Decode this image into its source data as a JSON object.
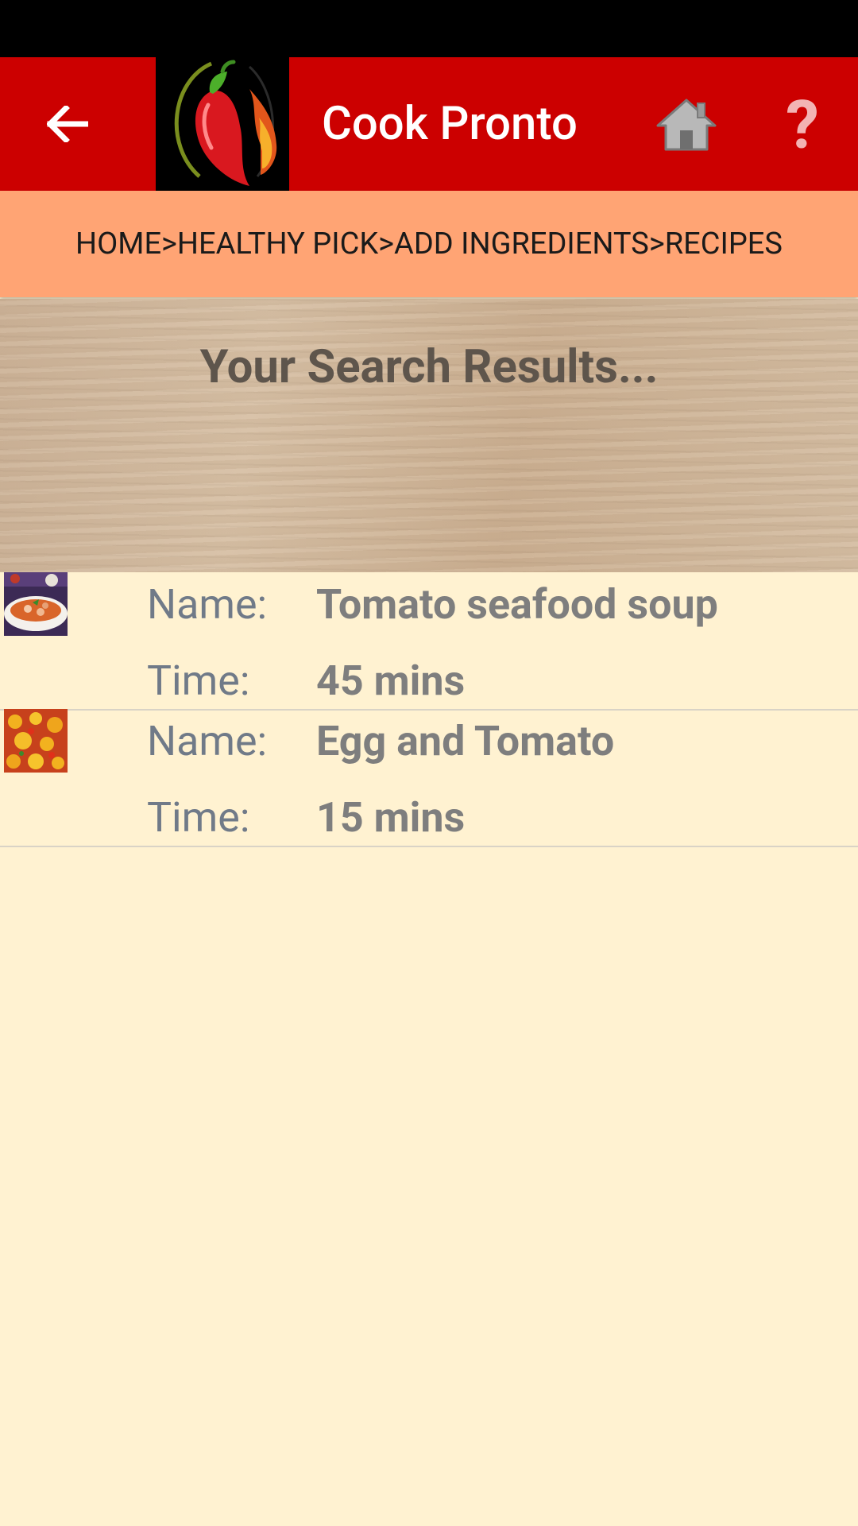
{
  "app": {
    "title": "Cook Pronto"
  },
  "breadcrumb": {
    "text": "HOME>HEALTHY PICK>ADD INGREDIENTS>RECIPES"
  },
  "hero": {
    "title": "Your Search Results..."
  },
  "labels": {
    "name": "Name:",
    "time": "Time:"
  },
  "recipes": [
    {
      "name": "Tomato seafood soup",
      "time": "45 mins"
    },
    {
      "name": "Egg and Tomato",
      "time": "15 mins"
    }
  ],
  "icons": {
    "back": "arrow-left-icon",
    "logo": "chili-flame-logo",
    "home": "home-icon",
    "help": "question-mark-icon"
  },
  "colors": {
    "app_bar": "#CC0000",
    "breadcrumb_bg": "#FFA474",
    "page_bg": "#FFF2D1"
  }
}
